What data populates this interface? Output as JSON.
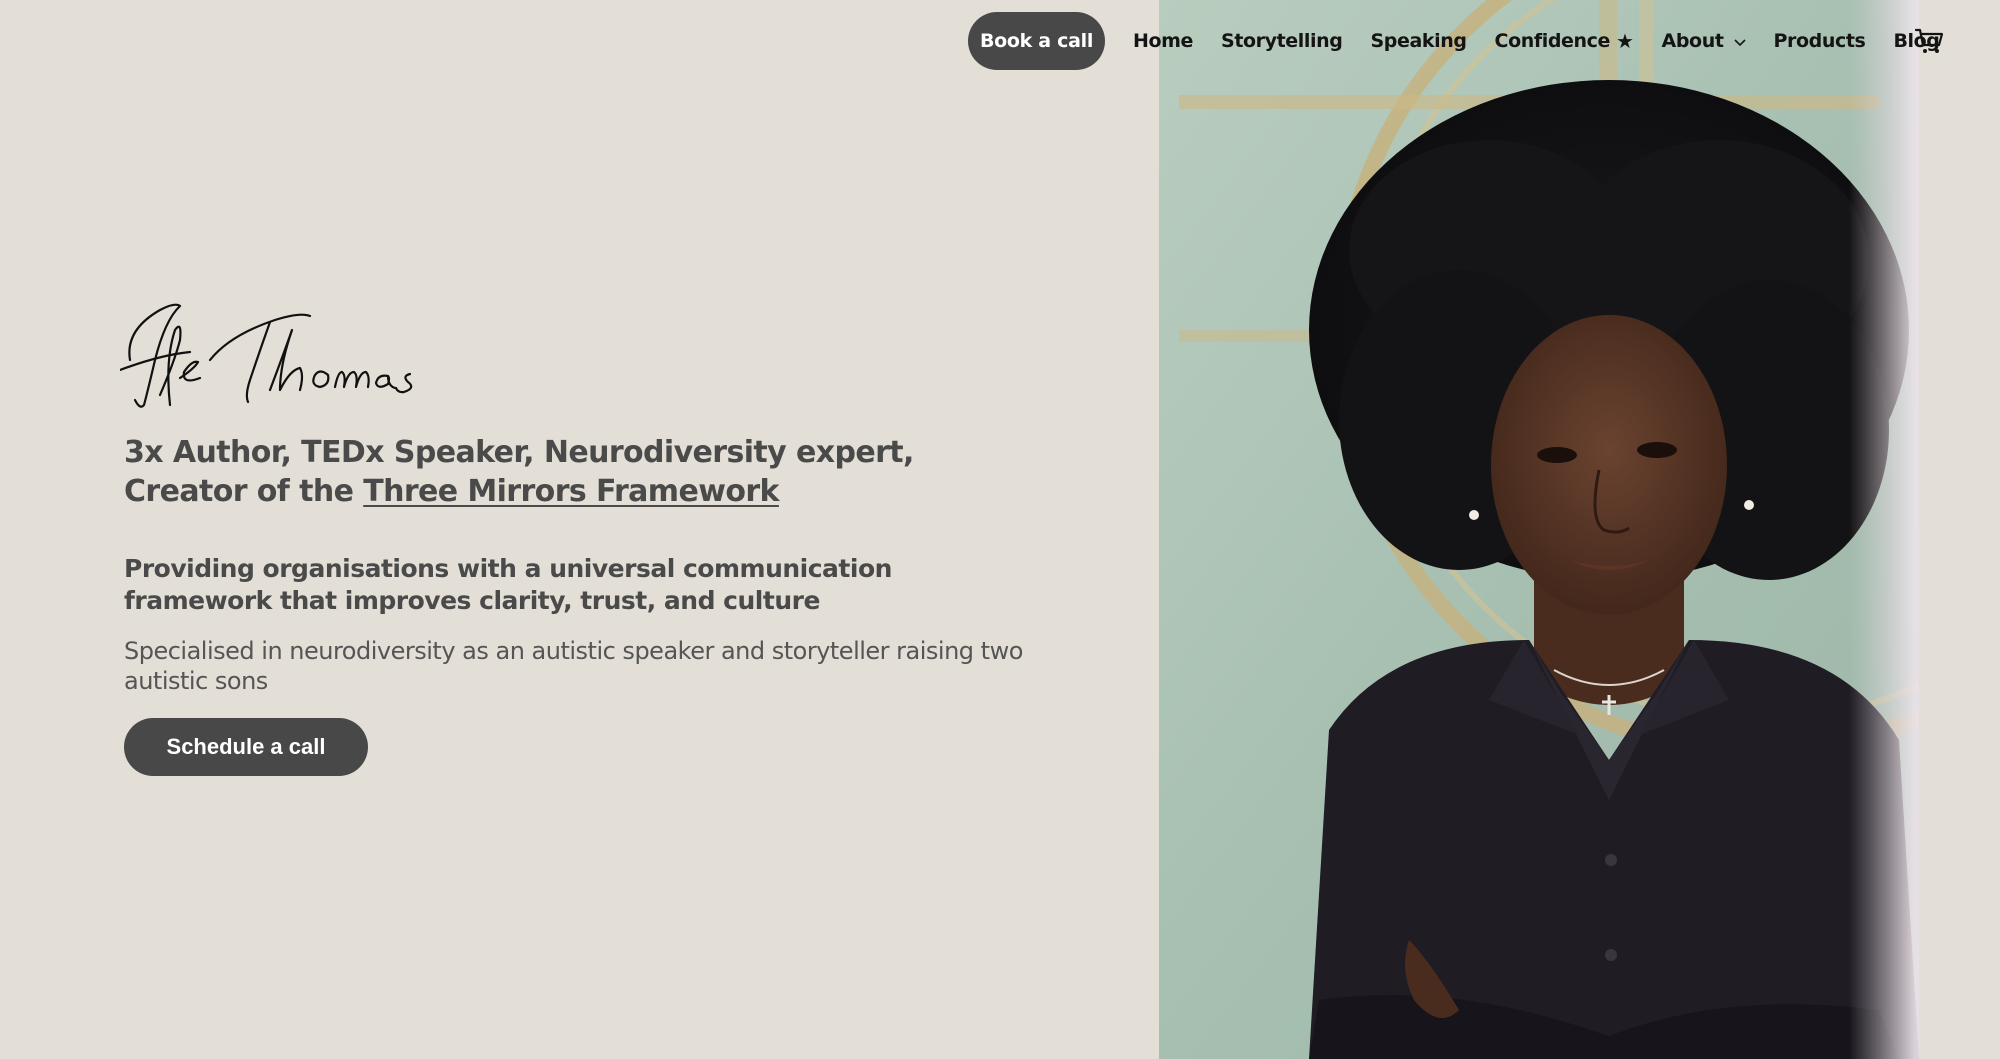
{
  "header": {
    "cta_label": "Book a call",
    "nav": [
      {
        "label": "Home"
      },
      {
        "label": "Storytelling"
      },
      {
        "label": "Speaking"
      },
      {
        "label": "Confidence",
        "suffix_icon": "star-icon",
        "suffix_glyph": "★"
      },
      {
        "label": "About",
        "has_dropdown": true
      },
      {
        "label": "Products"
      },
      {
        "label": "Blog"
      }
    ],
    "cart_icon": "cart-icon"
  },
  "hero": {
    "signature": "Ife Thomas",
    "headline_line1": "3x Author, TEDx Speaker, Neurodiversity expert,",
    "headline_line2_prefix": "Creator of the ",
    "headline_link": "Three Mirrors Framework",
    "subheadline": "Providing organisations with a universal communication framework that improves clarity, trust, and culture",
    "description": "Specialised in neurodiversity as an autistic speaker and storyteller raising two autistic sons",
    "cta_label": "Schedule a call"
  },
  "colors": {
    "background": "#e3dfd7",
    "button": "#484848",
    "button_text": "#ffffff",
    "heading_text": "#4a4a4a",
    "nav_text": "#141414",
    "photo_backdrop": "#a9c1b3"
  }
}
